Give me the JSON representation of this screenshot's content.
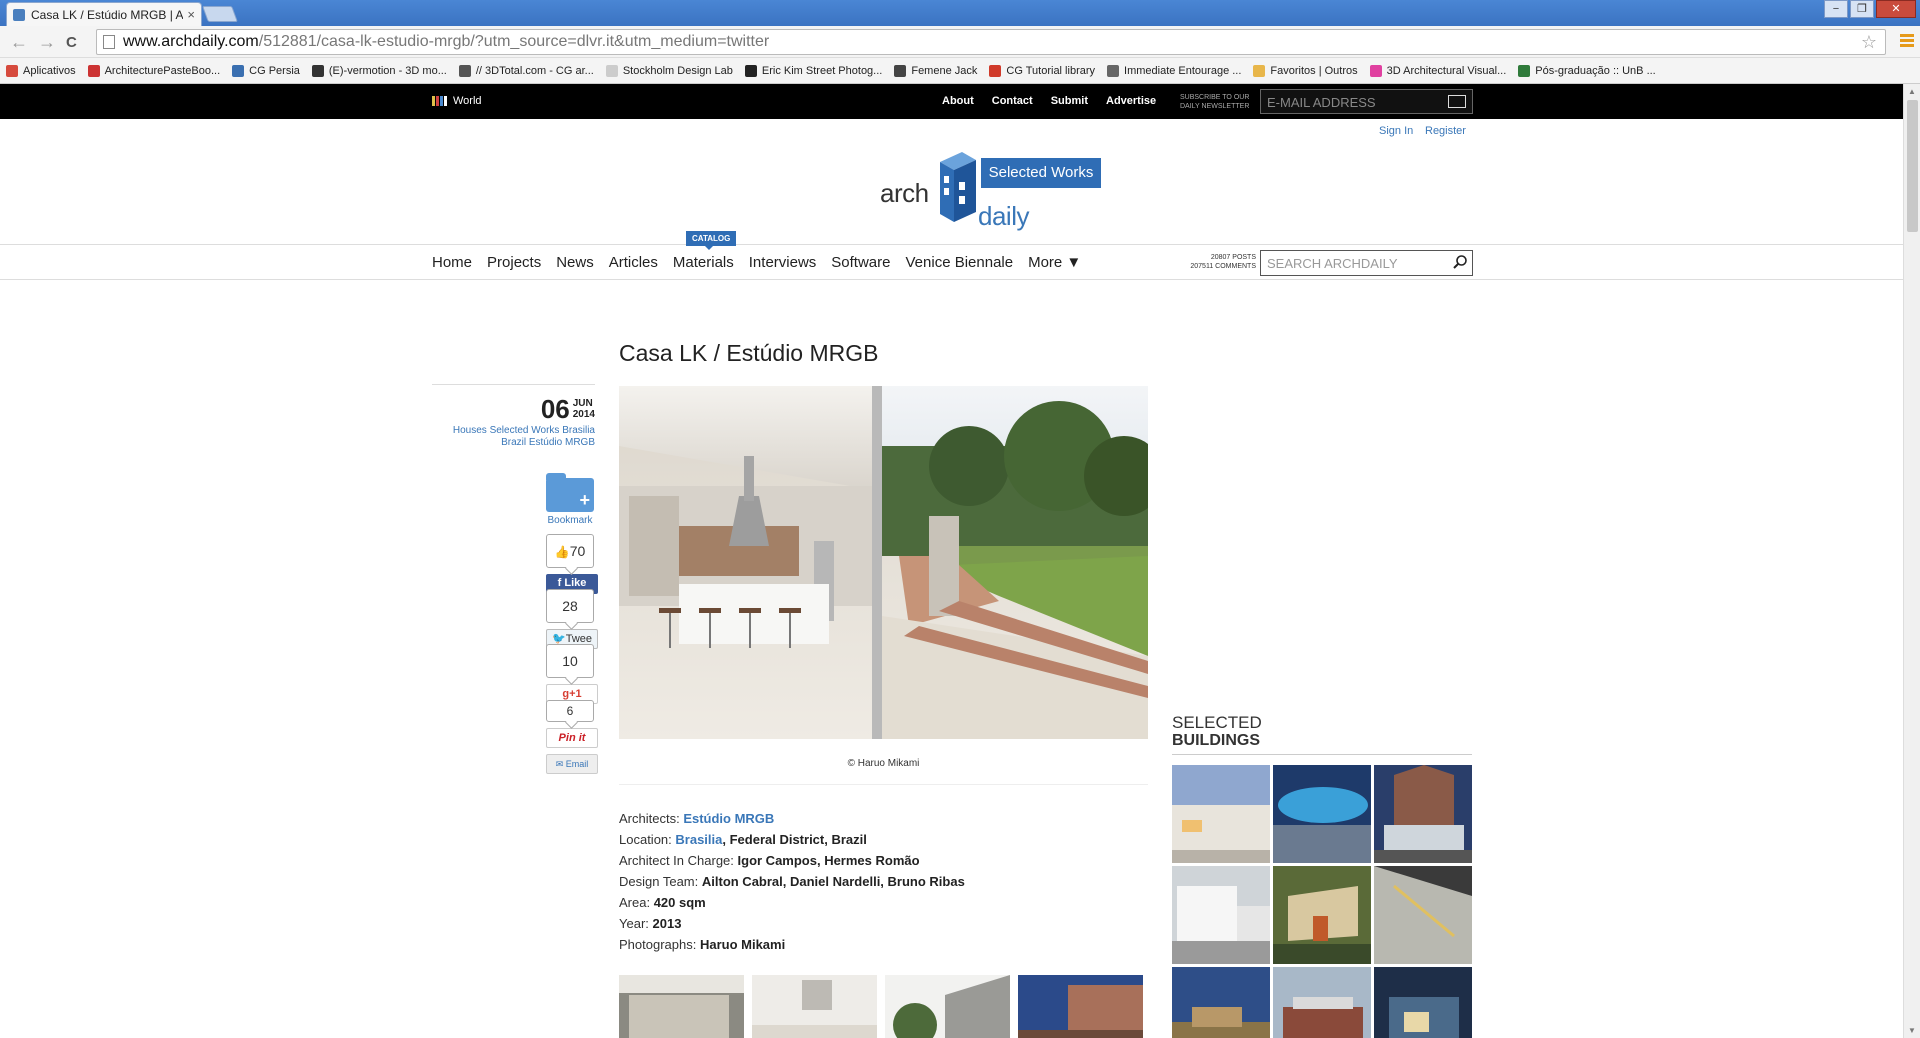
{
  "browser": {
    "tab_title": "Casa LK / Estúdio MRGB | Ar",
    "tab_close": "×",
    "url_host": "www.archdaily.com",
    "url_path": "/512881/casa-lk-estudio-mrgb/?utm_source=dlvr.it&utm_medium=twitter",
    "back": "←",
    "forward": "→",
    "reload": "C",
    "star": "☆",
    "window_minimize": "−",
    "window_maximize": "❐",
    "window_close": "✕"
  },
  "bookmarks": [
    {
      "label": "Aplicativos",
      "color": "#d64a3d"
    },
    {
      "label": "ArchitecturePasteBoo...",
      "color": "#cc3333"
    },
    {
      "label": "CG Persia",
      "color": "#3a6fb0"
    },
    {
      "label": "(E)-vermotion - 3D mo...",
      "color": "#333333"
    },
    {
      "label": "// 3DTotal.com - CG ar...",
      "color": "#555555"
    },
    {
      "label": "Stockholm Design Lab",
      "color": "#cccccc"
    },
    {
      "label": "Eric Kim Street Photog...",
      "color": "#222222"
    },
    {
      "label": "Femene Jack",
      "color": "#444444"
    },
    {
      "label": "CG Tutorial library",
      "color": "#d03a2a"
    },
    {
      "label": "Immediate Entourage ...",
      "color": "#666666"
    },
    {
      "label": "Favoritos | Outros",
      "color": "#e8b64a"
    },
    {
      "label": "3D Architectural Visual...",
      "color": "#e040a0"
    },
    {
      "label": "Pós-graduação :: UnB ...",
      "color": "#2f7a3a"
    }
  ],
  "topbar": {
    "world": "World",
    "links": [
      "About",
      "Contact",
      "Submit",
      "Advertise"
    ],
    "subscribe": "SUBSCRIBE TO OUR DAILY NEWSLETTER",
    "email_placeholder": "E-MAIL ADDRESS"
  },
  "auth": {
    "sign_in": "Sign In",
    "register": "Register"
  },
  "logo": {
    "arch": "arch",
    "daily": "daily",
    "badge": "Selected Works"
  },
  "nav": {
    "items": [
      "Home",
      "Projects",
      "News",
      "Articles",
      "Materials",
      "Interviews",
      "Software",
      "Venice Biennale",
      "More ▼"
    ],
    "catalog_badge": "CATALOG",
    "stats_posts": "20807 POSTS",
    "stats_comments": "207511 COMMENTS",
    "search_placeholder": "SEARCH ARCHDAILY"
  },
  "post": {
    "title": "Casa LK / Estúdio MRGB",
    "day": "06",
    "month": "JUN",
    "year": "2014",
    "tags_line1": "Houses  Selected Works  Brasilia",
    "tags_line2": "Brazil  Estúdio MRGB",
    "bookmark_label": "Bookmark",
    "likes": "70",
    "fb_label": "Like",
    "tweets": "28",
    "tw_label": "Twee",
    "gplus": "10",
    "gp_label": "g+1",
    "pins": "6",
    "pin_label": "Pin it",
    "email_label": "Email",
    "photo_credit": "© Haruo Mikami"
  },
  "specs": {
    "architects_label": "Architects:",
    "architects": "Estúdio MRGB",
    "location_label": "Location:",
    "location_link": "Brasilia",
    "location_rest": ", Federal District, Brazil",
    "charge_label": "Architect In Charge:",
    "charge": "Igor Campos, Hermes Romão",
    "team_label": "Design Team:",
    "team": "Ailton Cabral, Daniel Nardelli, Bruno Ribas",
    "area_label": "Area:",
    "area": "420 sqm",
    "year_label": "Year:",
    "year": "2013",
    "photos_label": "Photographs:",
    "photos": "Haruo Mikami"
  },
  "sidebar": {
    "selected": "SELECTED",
    "buildings": "BUILDINGS"
  }
}
